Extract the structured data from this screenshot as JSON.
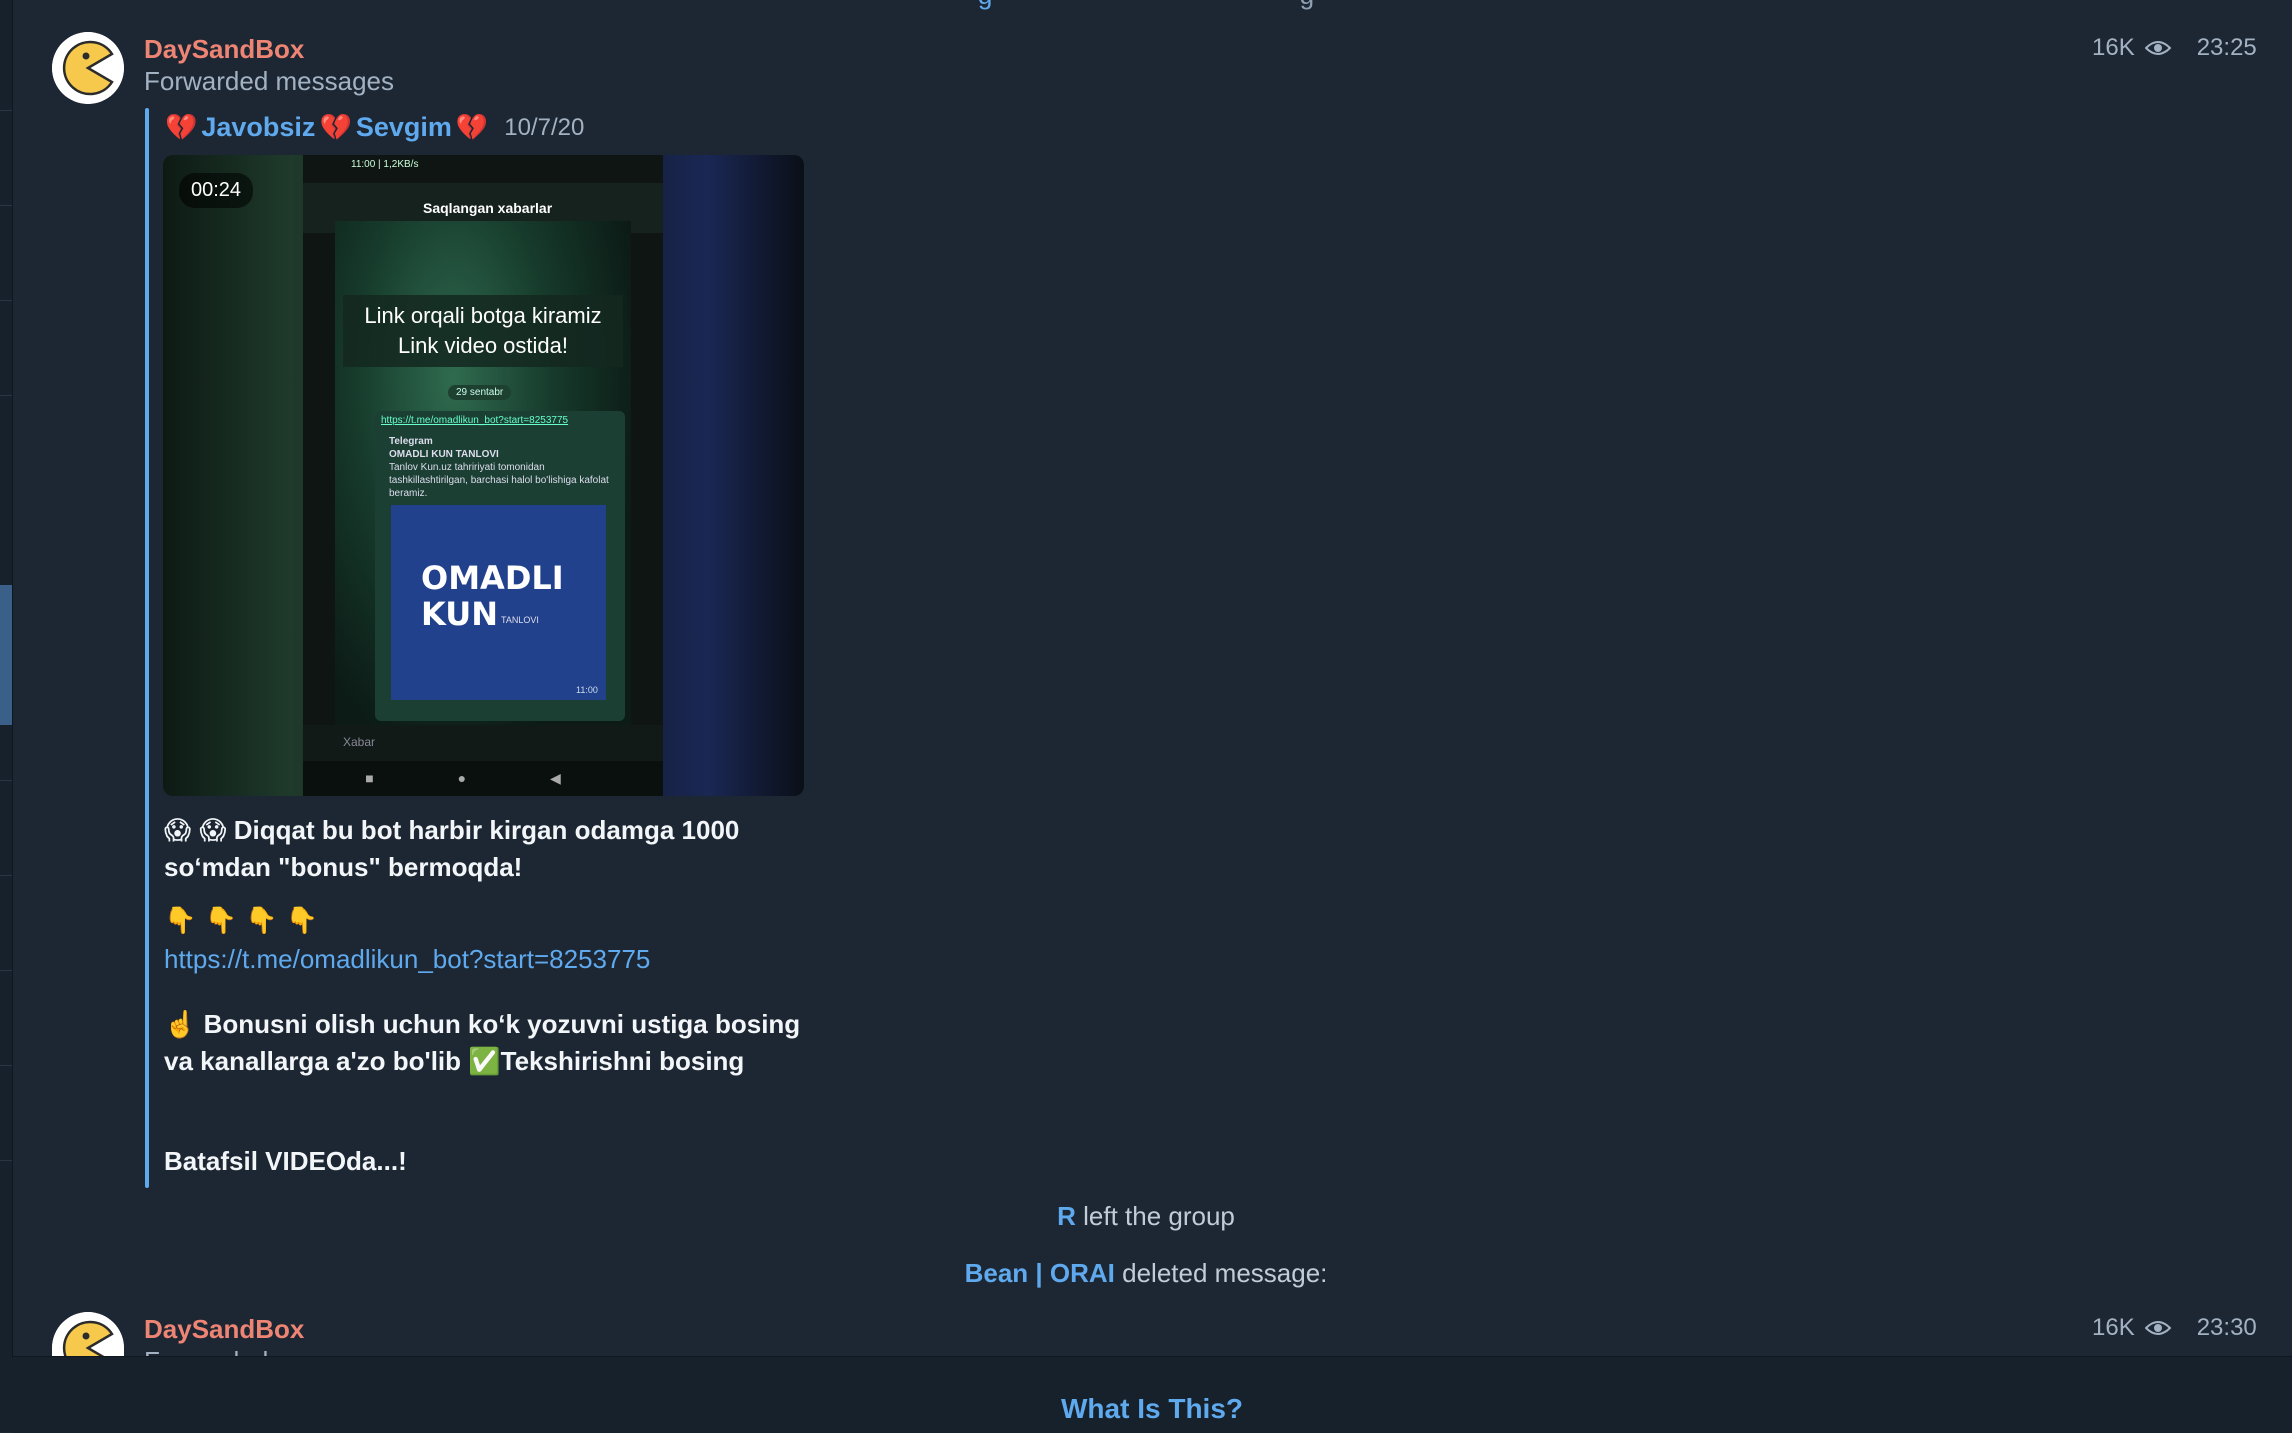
{
  "top_partial": {
    "highlight": "g",
    "text": "g"
  },
  "messages": [
    {
      "sender": "DaySandBox",
      "subtitle": "Forwarded messages",
      "views": "16K",
      "time": "23:25",
      "forward": {
        "heart": "💔",
        "name_1": "Javobsiz",
        "name_2": "Sevgim",
        "date": "10/7/20"
      },
      "video": {
        "duration": "00:24",
        "phone_status": "11:00 | 1,2KB/s",
        "phone_header": "Saqlangan xabarlar",
        "banner_line1": "Link orqali botga kiramiz",
        "banner_line2": "Link video ostida!",
        "date_chip": "29 sentabr",
        "bubble_link": "https://t.me/omadlikun_bot?start=8253775",
        "bubble_title": "Telegram",
        "bubble_subtitle": "OMADLI KUN TANLOVI",
        "bubble_body": "Tanlov Kun.uz tahririyati tomonidan tashkillashtirilgan, barchasi halol bo'lishiga kafolat beramiz.",
        "poster_line1": "OMADLI",
        "poster_line2": "KUN",
        "poster_sub": "TANLOVI",
        "poster_time": "11:00",
        "input_placeholder": "Xabar",
        "nav": "■ ● ◀"
      },
      "text_1_emoji": "😱 😱",
      "text_1": "Diqqat bu bot harbir kirgan odamga 1000 soʻmdan \"bonus\" bermoqda!",
      "text_2_emoji": "👇 👇 👇 👇",
      "link": "https://t.me/omadlikun_bot?start=8253775",
      "text_3_emoji": "☝️",
      "text_3a": "Bonusni olish uchun koʻk yozuvni ustiga bosing va kanallarga a'zo bo'lib",
      "text_3_check": "✅",
      "text_3b": "Tekshirishni bosing",
      "text_4": "Batafsil VIDEOda...!"
    },
    {
      "sender": "DaySandBox",
      "subtitle": "Forwarded messages",
      "views": "16K",
      "time": "23:30"
    }
  ],
  "service": [
    {
      "who": "R",
      "text": "left the group"
    },
    {
      "who": "Bean | ORAI",
      "text": "deleted message:"
    }
  ],
  "bottom": {
    "button": "What Is This?"
  },
  "colors": {
    "accent": "#5fa9ee",
    "sender": "#ee8574",
    "background": "#1d2733"
  },
  "icons": [
    "pacman-avatar-icon",
    "eye-icon"
  ]
}
